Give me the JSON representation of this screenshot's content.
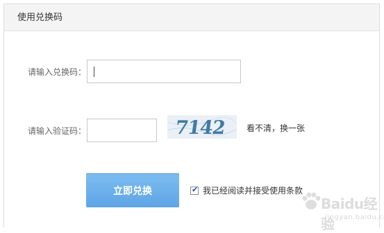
{
  "panel": {
    "title": "使用兑换码"
  },
  "redeem": {
    "label": "请输入兑换码：",
    "value": ""
  },
  "captcha": {
    "label": "请输入验证码：",
    "value": "",
    "image_text": "7142",
    "refresh_label": "看不清，换一张"
  },
  "actions": {
    "submit_label": "立即兑换",
    "agree_checked": true,
    "agree_label": "我已经阅读并接受使用条款"
  },
  "watermark": {
    "brand": "Baidu经验",
    "sub": "jingyan.baidu.com"
  }
}
